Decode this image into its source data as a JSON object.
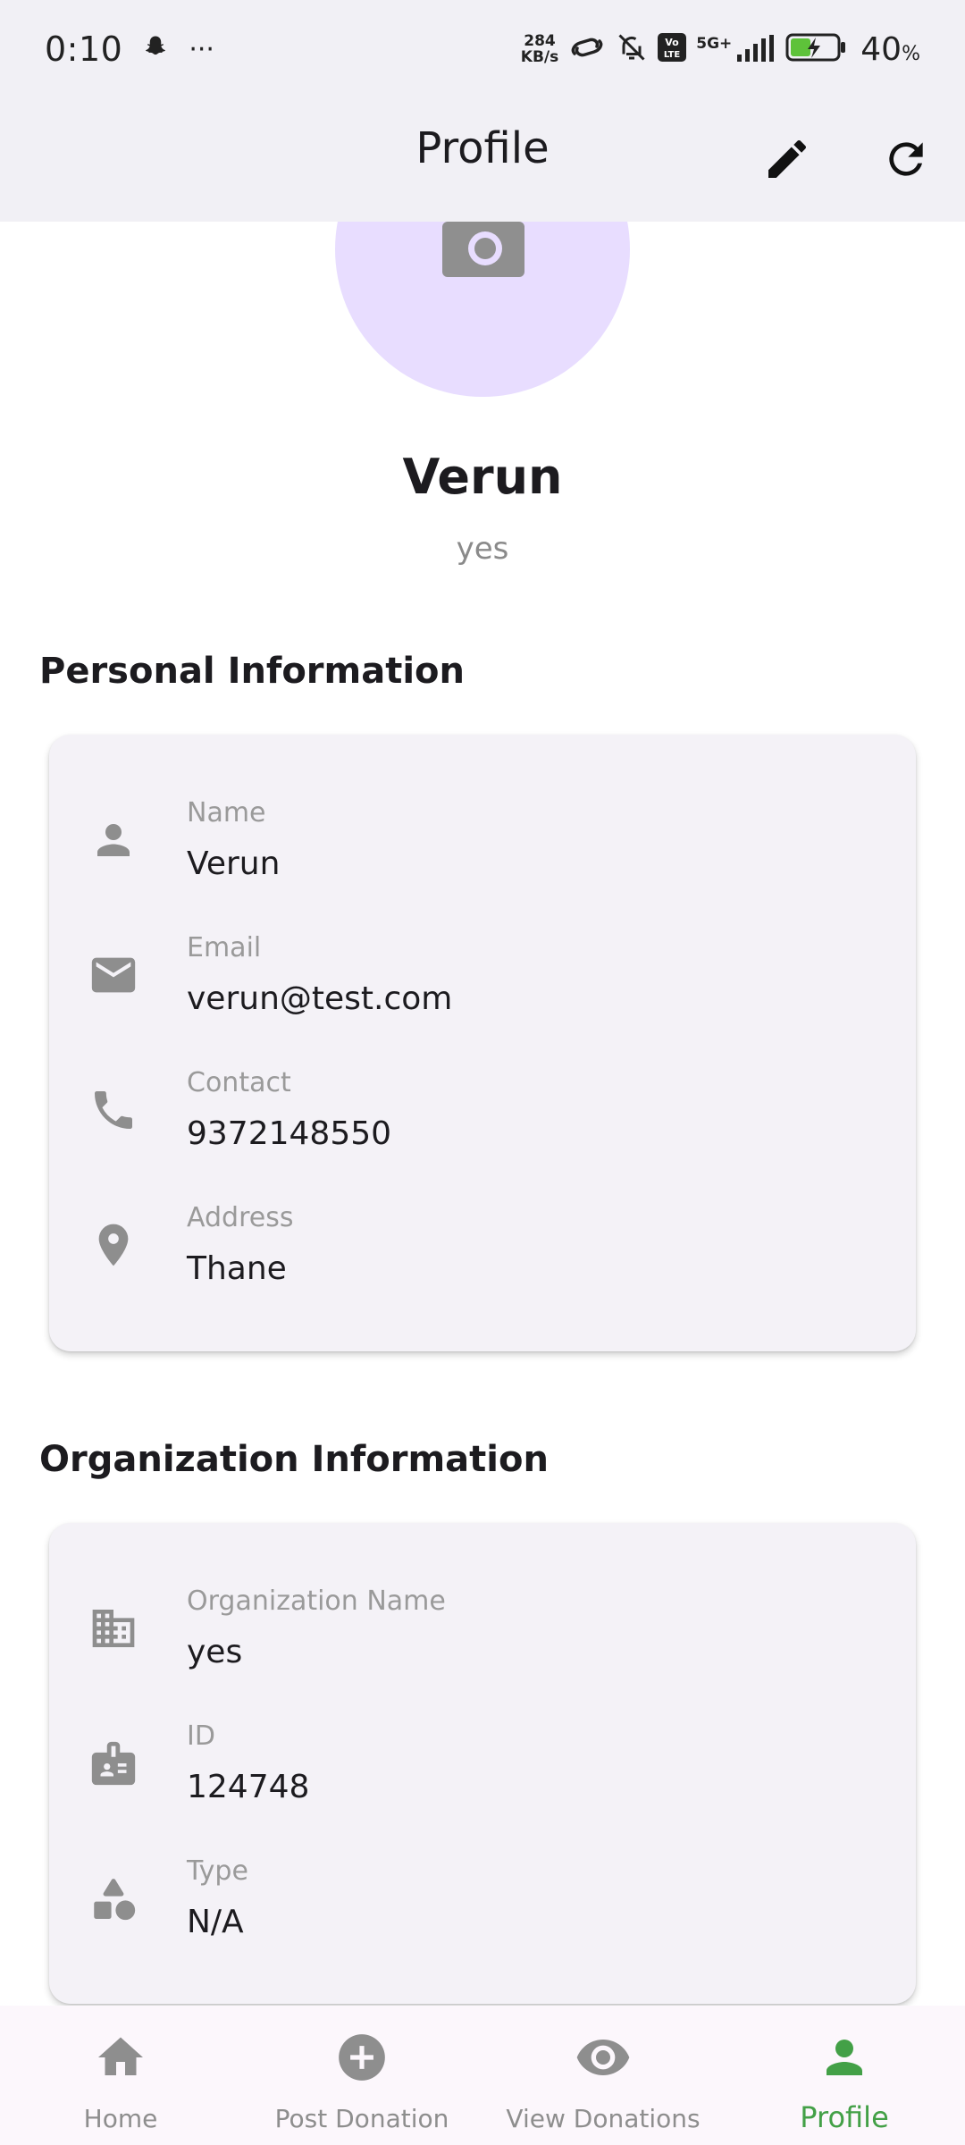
{
  "status_bar": {
    "time": "0:10",
    "more": "···",
    "net_speed_value": "284",
    "net_speed_unit": "KB/s",
    "network": "5G+",
    "battery": "40",
    "battery_unit": "%"
  },
  "app_bar": {
    "title": "Profile",
    "edit_icon": "pencil-icon",
    "refresh_icon": "refresh-icon"
  },
  "profile": {
    "avatar_icon": "add-photo-icon",
    "name": "Verun",
    "organization": "yes"
  },
  "personal": {
    "title": "Personal Information",
    "rows": [
      {
        "icon": "person-icon",
        "label": "Name",
        "value": "Verun"
      },
      {
        "icon": "email-icon",
        "label": "Email",
        "value": "verun@test.com"
      },
      {
        "icon": "phone-icon",
        "label": "Contact",
        "value": "9372148550"
      },
      {
        "icon": "location-icon",
        "label": "Address",
        "value": "Thane"
      }
    ]
  },
  "organization": {
    "title": "Organization Information",
    "rows": [
      {
        "icon": "building-icon",
        "label": "Organization Name",
        "value": "yes"
      },
      {
        "icon": "badge-icon",
        "label": "ID",
        "value": "124748"
      },
      {
        "icon": "category-icon",
        "label": "Type",
        "value": "N/A"
      }
    ]
  },
  "bottom_nav": {
    "items": [
      {
        "icon": "home-icon",
        "label": "Home",
        "active": false
      },
      {
        "icon": "add-circle-icon",
        "label": "Post Donation",
        "active": false
      },
      {
        "icon": "eye-icon",
        "label": "View Donations",
        "active": false
      },
      {
        "icon": "person-icon",
        "label": "Profile",
        "active": true
      }
    ]
  },
  "colors": {
    "accent": "#43a047",
    "avatar_bg": "#e8ddff",
    "card_bg": "#f4f2f7",
    "icon_grey": "#8e8e8e"
  }
}
